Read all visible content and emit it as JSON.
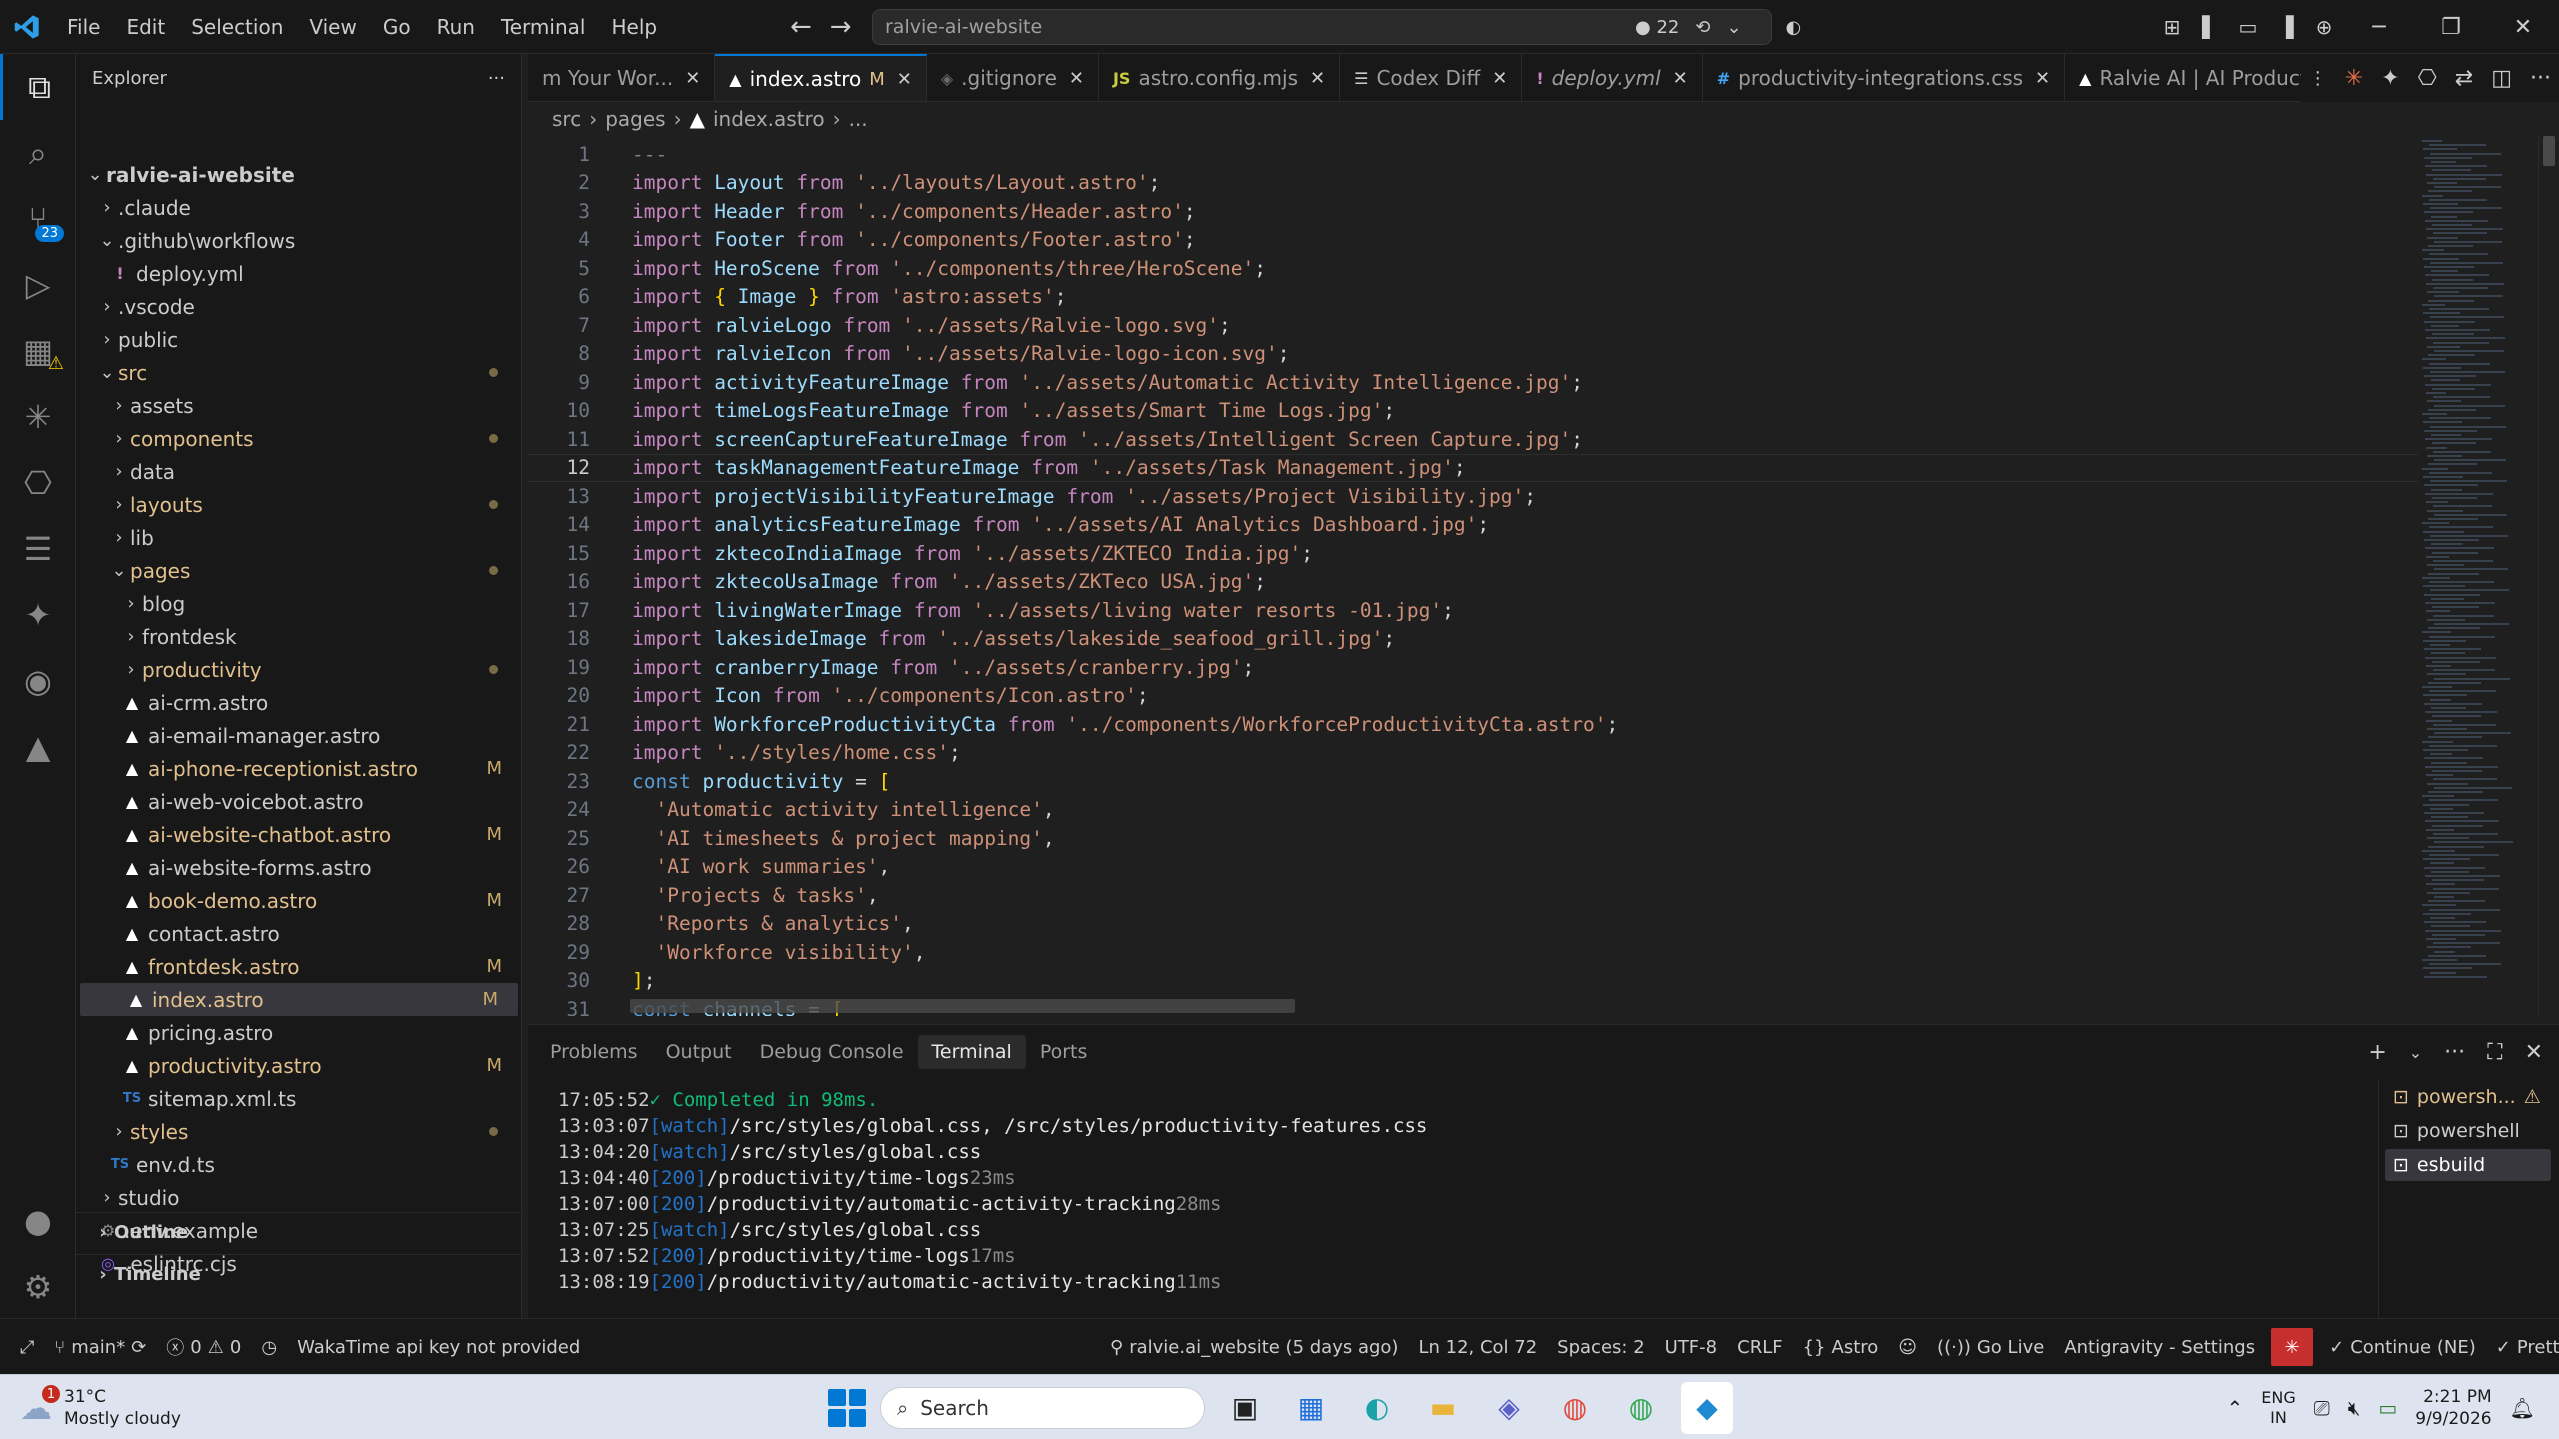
{
  "titlebar": {
    "menu": [
      "File",
      "Edit",
      "Selection",
      "View",
      "Go",
      "Run",
      "Terminal",
      "Help"
    ],
    "command_center": "ralvie-ai-website",
    "changes_count": "22"
  },
  "activity": {
    "scm_badge": "23"
  },
  "sidebar": {
    "title": "Explorer",
    "root": "ralvie-ai-website",
    "items": [
      {
        "label": ".claude",
        "type": "dir",
        "indent": 1,
        "open": false
      },
      {
        "label": ".github\\workflows",
        "type": "dir",
        "indent": 1,
        "open": true
      },
      {
        "label": "deploy.yml",
        "type": "yml",
        "indent": 2
      },
      {
        "label": ".vscode",
        "type": "dir",
        "indent": 1,
        "open": false
      },
      {
        "label": "public",
        "type": "dir",
        "indent": 1,
        "open": false
      },
      {
        "label": "src",
        "type": "dir",
        "indent": 1,
        "open": true,
        "dot": true
      },
      {
        "label": "assets",
        "type": "dir",
        "indent": 2,
        "open": false
      },
      {
        "label": "components",
        "type": "dir",
        "indent": 2,
        "open": false,
        "dot": true
      },
      {
        "label": "data",
        "type": "dir",
        "indent": 2,
        "open": false
      },
      {
        "label": "layouts",
        "type": "dir",
        "indent": 2,
        "open": false,
        "dot": true
      },
      {
        "label": "lib",
        "type": "dir",
        "indent": 2,
        "open": false
      },
      {
        "label": "pages",
        "type": "dir",
        "indent": 2,
        "open": true,
        "dot": true
      },
      {
        "label": "blog",
        "type": "dir",
        "indent": 3,
        "open": false
      },
      {
        "label": "frontdesk",
        "type": "dir",
        "indent": 3,
        "open": false
      },
      {
        "label": "productivity",
        "type": "dir",
        "indent": 3,
        "open": false,
        "dot": true
      },
      {
        "label": "ai-crm.astro",
        "type": "astro",
        "indent": 3
      },
      {
        "label": "ai-email-manager.astro",
        "type": "astro",
        "indent": 3
      },
      {
        "label": "ai-phone-receptionist.astro",
        "type": "astro",
        "indent": 3,
        "mod": "M"
      },
      {
        "label": "ai-web-voicebot.astro",
        "type": "astro",
        "indent": 3
      },
      {
        "label": "ai-website-chatbot.astro",
        "type": "astro",
        "indent": 3,
        "mod": "M"
      },
      {
        "label": "ai-website-forms.astro",
        "type": "astro",
        "indent": 3
      },
      {
        "label": "book-demo.astro",
        "type": "astro",
        "indent": 3,
        "mod": "M"
      },
      {
        "label": "contact.astro",
        "type": "astro",
        "indent": 3
      },
      {
        "label": "frontdesk.astro",
        "type": "astro",
        "indent": 3,
        "mod": "M"
      },
      {
        "label": "index.astro",
        "type": "astro",
        "indent": 3,
        "mod": "M",
        "selected": true
      },
      {
        "label": "pricing.astro",
        "type": "astro",
        "indent": 3
      },
      {
        "label": "productivity.astro",
        "type": "astro",
        "indent": 3,
        "mod": "M"
      },
      {
        "label": "sitemap.xml.ts",
        "type": "ts",
        "indent": 3
      },
      {
        "label": "styles",
        "type": "dir",
        "indent": 2,
        "open": false,
        "dot": true
      },
      {
        "label": "env.d.ts",
        "type": "ts",
        "indent": 2
      },
      {
        "label": "studio",
        "type": "dir",
        "indent": 1,
        "open": false
      },
      {
        "label": ".env.example",
        "type": "gear",
        "indent": 1
      },
      {
        "label": ".eslintrc.cjs",
        "type": "eslint",
        "indent": 1
      }
    ],
    "outline": "Outline",
    "timeline": "Timeline"
  },
  "tabs": [
    {
      "label": "m Your Wor...",
      "icon": "",
      "active": false
    },
    {
      "label": "index.astro",
      "icon": "astro-icon",
      "active": true,
      "mod": "M"
    },
    {
      "label": ".gitignore",
      "icon": "git-icon",
      "active": false
    },
    {
      "label": "astro.config.mjs",
      "icon": "js-icon",
      "active": false
    },
    {
      "label": "Codex Diff",
      "icon": "diff-icon",
      "active": false
    },
    {
      "label": "deploy.yml",
      "icon": "yml-icon",
      "active": false
    },
    {
      "label": "productivity-integrations.css",
      "icon": "css-icon",
      "active": false
    },
    {
      "label": "Ralvie AI | AI Productivity & ...",
      "icon": "astro-icon",
      "active": false
    }
  ],
  "breadcrumb": [
    "src",
    "pages",
    "index.astro",
    "..."
  ],
  "editor": {
    "current_line": 12,
    "lines": [
      [
        [
          "dash",
          "---"
        ]
      ],
      [
        [
          "kw",
          "import "
        ],
        [
          "id",
          "Layout"
        ],
        [
          "kw",
          " from "
        ],
        [
          "str",
          "'../layouts/Layout.astro'"
        ],
        [
          "pun",
          ";"
        ]
      ],
      [
        [
          "kw",
          "import "
        ],
        [
          "id",
          "Header"
        ],
        [
          "kw",
          " from "
        ],
        [
          "str",
          "'../components/Header.astro'"
        ],
        [
          "pun",
          ";"
        ]
      ],
      [
        [
          "kw",
          "import "
        ],
        [
          "id",
          "Footer"
        ],
        [
          "kw",
          " from "
        ],
        [
          "str",
          "'../components/Footer.astro'"
        ],
        [
          "pun",
          ";"
        ]
      ],
      [
        [
          "kw",
          "import "
        ],
        [
          "id",
          "HeroScene"
        ],
        [
          "kw",
          " from "
        ],
        [
          "str",
          "'../components/three/HeroScene'"
        ],
        [
          "pun",
          ";"
        ]
      ],
      [
        [
          "kw",
          "import "
        ],
        [
          "br",
          "{ "
        ],
        [
          "id",
          "Image"
        ],
        [
          "br",
          " }"
        ],
        [
          "kw",
          " from "
        ],
        [
          "str",
          "'astro:assets'"
        ],
        [
          "pun",
          ";"
        ]
      ],
      [
        [
          "kw",
          "import "
        ],
        [
          "id",
          "ralvieLogo"
        ],
        [
          "kw",
          " from "
        ],
        [
          "str",
          "'../assets/Ralvie-logo.svg'"
        ],
        [
          "pun",
          ";"
        ]
      ],
      [
        [
          "kw",
          "import "
        ],
        [
          "id",
          "ralvieIcon"
        ],
        [
          "kw",
          " from "
        ],
        [
          "str",
          "'../assets/Ralvie-logo-icon.svg'"
        ],
        [
          "pun",
          ";"
        ]
      ],
      [
        [
          "kw",
          "import "
        ],
        [
          "id",
          "activityFeatureImage"
        ],
        [
          "kw",
          " from "
        ],
        [
          "str",
          "'../assets/Automatic Activity Intelligence.jpg'"
        ],
        [
          "pun",
          ";"
        ]
      ],
      [
        [
          "kw",
          "import "
        ],
        [
          "id",
          "timeLogsFeatureImage"
        ],
        [
          "kw",
          " from "
        ],
        [
          "str",
          "'../assets/Smart Time Logs.jpg'"
        ],
        [
          "pun",
          ";"
        ]
      ],
      [
        [
          "kw",
          "import "
        ],
        [
          "id",
          "screenCaptureFeatureImage"
        ],
        [
          "kw",
          " from "
        ],
        [
          "str",
          "'../assets/Intelligent Screen Capture.jpg'"
        ],
        [
          "pun",
          ";"
        ]
      ],
      [
        [
          "kw",
          "import "
        ],
        [
          "id",
          "taskManagementFeatureImage"
        ],
        [
          "kw",
          " from "
        ],
        [
          "str",
          "'../assets/Task Management.jpg'"
        ],
        [
          "pun",
          ";"
        ]
      ],
      [
        [
          "kw",
          "import "
        ],
        [
          "id",
          "projectVisibilityFeatureImage"
        ],
        [
          "kw",
          " from "
        ],
        [
          "str",
          "'../assets/Project Visibility.jpg'"
        ],
        [
          "pun",
          ";"
        ]
      ],
      [
        [
          "kw",
          "import "
        ],
        [
          "id",
          "analyticsFeatureImage"
        ],
        [
          "kw",
          " from "
        ],
        [
          "str",
          "'../assets/AI Analytics Dashboard.jpg'"
        ],
        [
          "pun",
          ";"
        ]
      ],
      [
        [
          "kw",
          "import "
        ],
        [
          "id",
          "zktecoIndiaImage"
        ],
        [
          "kw",
          " from "
        ],
        [
          "str",
          "'../assets/ZKTECO India.jpg'"
        ],
        [
          "pun",
          ";"
        ]
      ],
      [
        [
          "kw",
          "import "
        ],
        [
          "id",
          "zktecoUsaImage"
        ],
        [
          "kw",
          " from "
        ],
        [
          "str",
          "'../assets/ZKTeco USA.jpg'"
        ],
        [
          "pun",
          ";"
        ]
      ],
      [
        [
          "kw",
          "import "
        ],
        [
          "id",
          "livingWaterImage"
        ],
        [
          "kw",
          " from "
        ],
        [
          "str",
          "'../assets/living water resorts -01.jpg'"
        ],
        [
          "pun",
          ";"
        ]
      ],
      [
        [
          "kw",
          "import "
        ],
        [
          "id",
          "lakesideImage"
        ],
        [
          "kw",
          " from "
        ],
        [
          "str",
          "'../assets/lakeside_seafood_grill.jpg'"
        ],
        [
          "pun",
          ";"
        ]
      ],
      [
        [
          "kw",
          "import "
        ],
        [
          "id",
          "cranberryImage"
        ],
        [
          "kw",
          " from "
        ],
        [
          "str",
          "'../assets/cranberry.jpg'"
        ],
        [
          "pun",
          ";"
        ]
      ],
      [
        [
          "kw",
          "import "
        ],
        [
          "id",
          "Icon"
        ],
        [
          "kw",
          " from "
        ],
        [
          "str",
          "'../components/Icon.astro'"
        ],
        [
          "pun",
          ";"
        ]
      ],
      [
        [
          "kw",
          "import "
        ],
        [
          "id",
          "WorkforceProductivityCta"
        ],
        [
          "kw",
          " from "
        ],
        [
          "str",
          "'../components/WorkforceProductivityCta.astro'"
        ],
        [
          "pun",
          ";"
        ]
      ],
      [
        [
          "kw",
          "import "
        ],
        [
          "str",
          "'../styles/home.css'"
        ],
        [
          "pun",
          ";"
        ]
      ],
      [
        [
          "cst",
          "const "
        ],
        [
          "id",
          "productivity"
        ],
        [
          "pun",
          " = "
        ],
        [
          "br",
          "["
        ]
      ],
      [
        [
          "pun",
          "  "
        ],
        [
          "str",
          "'Automatic activity intelligence'"
        ],
        [
          "pun",
          ","
        ]
      ],
      [
        [
          "pun",
          "  "
        ],
        [
          "str",
          "'AI timesheets & project mapping'"
        ],
        [
          "pun",
          ","
        ]
      ],
      [
        [
          "pun",
          "  "
        ],
        [
          "str",
          "'AI work summaries'"
        ],
        [
          "pun",
          ","
        ]
      ],
      [
        [
          "pun",
          "  "
        ],
        [
          "str",
          "'Projects & tasks'"
        ],
        [
          "pun",
          ","
        ]
      ],
      [
        [
          "pun",
          "  "
        ],
        [
          "str",
          "'Reports & analytics'"
        ],
        [
          "pun",
          ","
        ]
      ],
      [
        [
          "pun",
          "  "
        ],
        [
          "str",
          "'Workforce visibility'"
        ],
        [
          "pun",
          ","
        ]
      ],
      [
        [
          "br",
          "]"
        ],
        [
          "pun",
          ";"
        ]
      ],
      [
        [
          "cst",
          "const "
        ],
        [
          "id",
          "channels"
        ],
        [
          "pun",
          " = "
        ],
        [
          "br",
          "["
        ]
      ]
    ]
  },
  "panel": {
    "tabs": [
      "Problems",
      "Output",
      "Debug Console",
      "Terminal",
      "Ports"
    ],
    "active_tab": "Terminal",
    "terminal_lines": [
      {
        "time": "17:05:52",
        "tag": "✓ Completed in 98ms.",
        "kind": "ok",
        "path": "",
        "ms": ""
      },
      {
        "time": "13:03:07",
        "tag": "[watch]",
        "kind": "watch",
        "path": "/src/styles/global.css, /src/styles/productivity-features.css",
        "ms": ""
      },
      {
        "time": "13:04:20",
        "tag": "[watch]",
        "kind": "watch",
        "path": "/src/styles/global.css",
        "ms": ""
      },
      {
        "time": "13:04:40",
        "tag": "[200]",
        "kind": "200",
        "path": "/productivity/time-logs",
        "ms": "23ms"
      },
      {
        "time": "13:07:00",
        "tag": "[200]",
        "kind": "200",
        "path": "/productivity/automatic-activity-tracking",
        "ms": "28ms"
      },
      {
        "time": "13:07:25",
        "tag": "[watch]",
        "kind": "watch",
        "path": "/src/styles/global.css",
        "ms": ""
      },
      {
        "time": "13:07:52",
        "tag": "[200]",
        "kind": "200",
        "path": "/productivity/time-logs",
        "ms": "17ms"
      },
      {
        "time": "13:08:19",
        "tag": "[200]",
        "kind": "200",
        "path": "/productivity/automatic-activity-tracking",
        "ms": "11ms"
      }
    ],
    "terminals": [
      {
        "label": "powersh...",
        "warn": true
      },
      {
        "label": "powershell",
        "warn": false
      },
      {
        "label": "esbuild",
        "warn": false,
        "selected": true
      }
    ]
  },
  "statusbar": {
    "branch": "main*",
    "errors": "0",
    "warnings": "0",
    "wakatime": "WakaTime api key not provided",
    "git_info": "ralvie.ai_website (5 days ago)",
    "position": "Ln 12, Col 72",
    "spaces": "Spaces: 2",
    "encoding": "UTF-8",
    "eol": "CRLF",
    "language": "Astro",
    "golive": "Go Live",
    "antigravity": "Antigravity - Settings",
    "continue": "Continue (NE)",
    "prettier": "Prettier"
  },
  "taskbar": {
    "weather_badge": "1",
    "temp": "31°C",
    "condition": "Mostly cloudy",
    "search_placeholder": "Search",
    "lang_top": "ENG",
    "lang_bottom": "IN",
    "time": "2:21 PM",
    "date": "9/9/2026"
  }
}
